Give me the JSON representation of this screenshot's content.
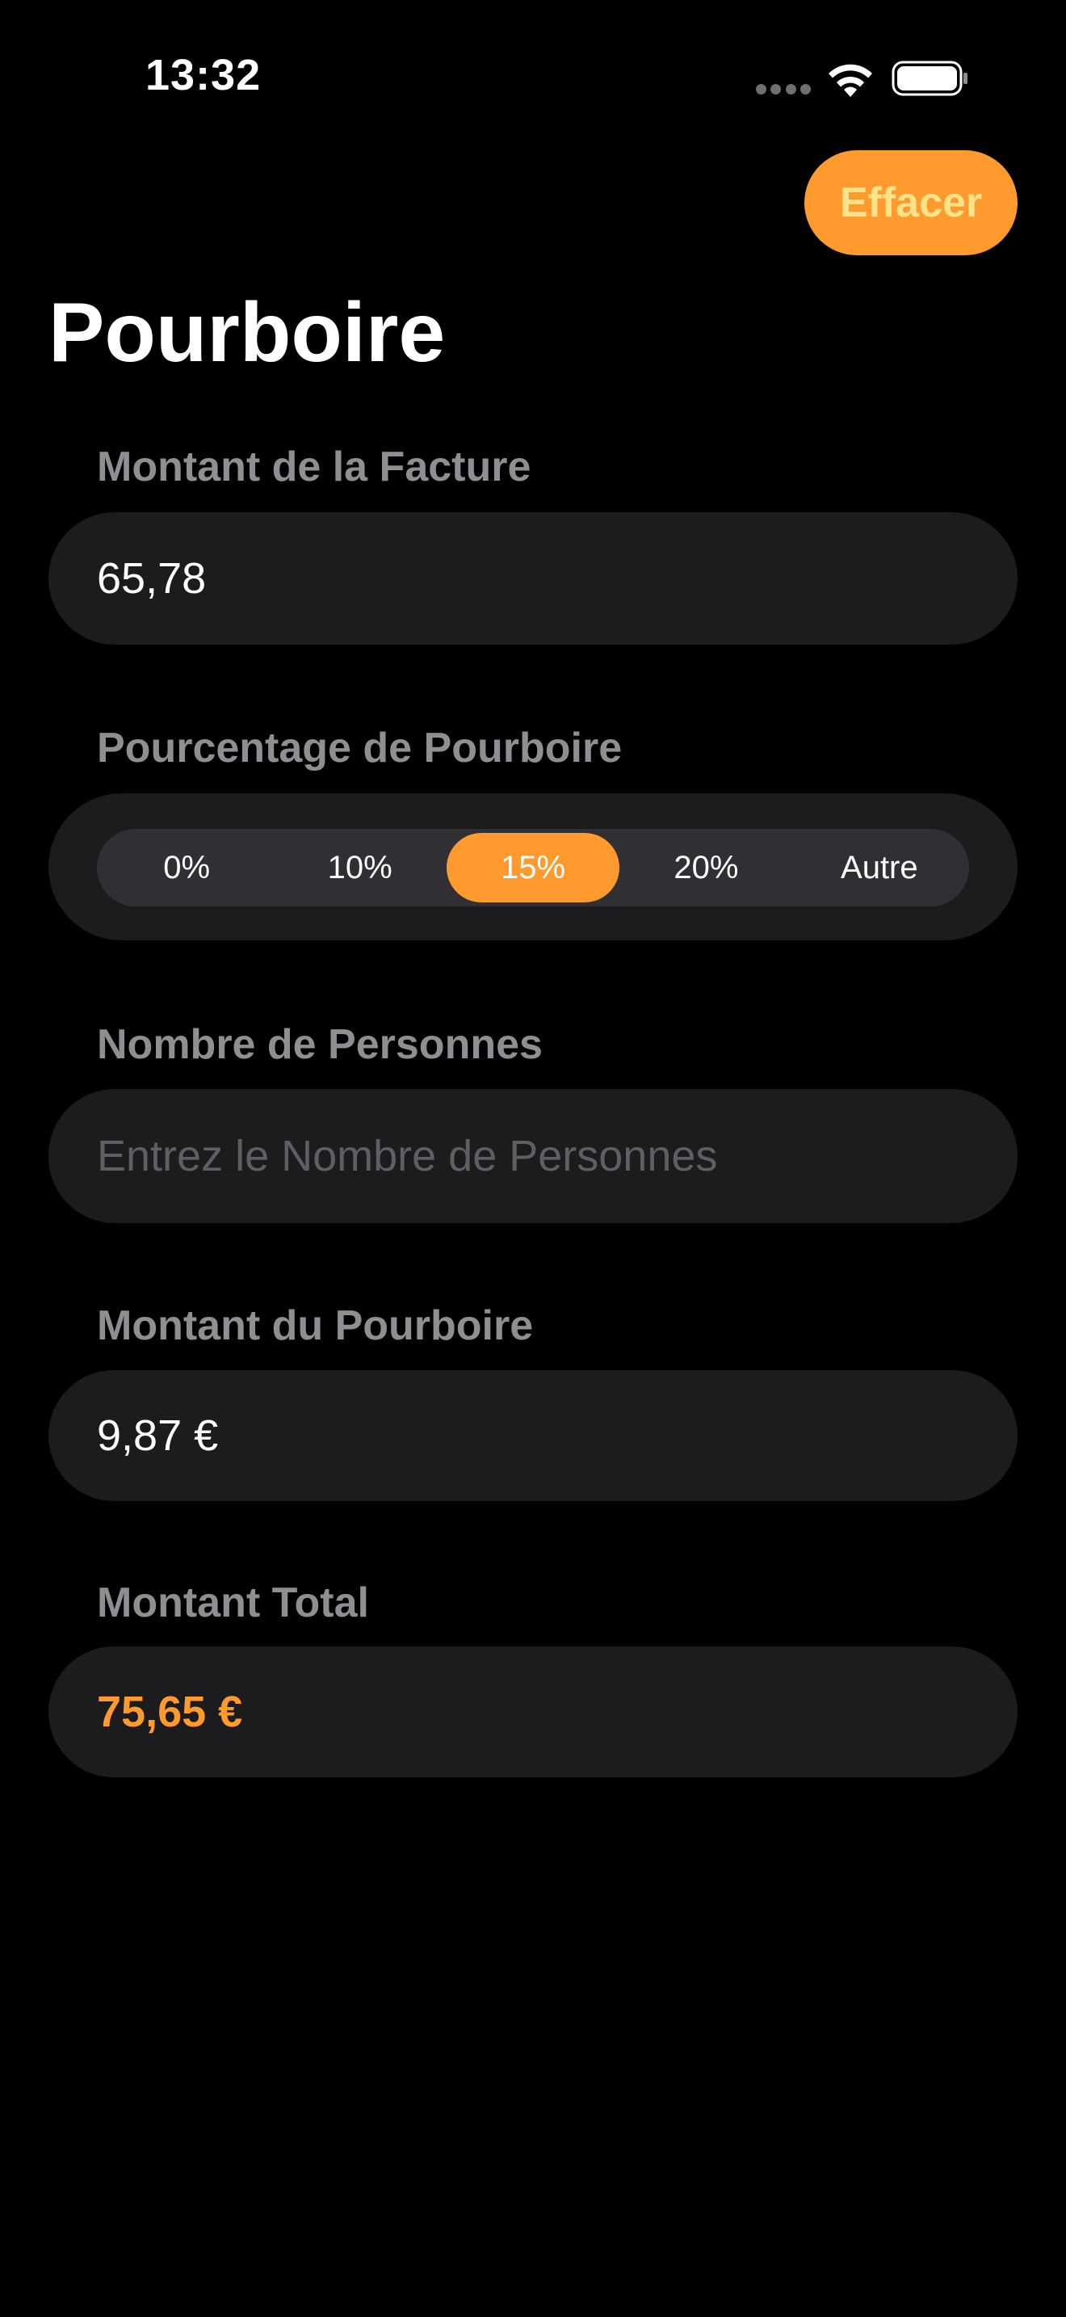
{
  "status_bar": {
    "time": "13:32",
    "icons": [
      "signal-icon",
      "wifi-icon",
      "battery-icon"
    ]
  },
  "toolbar": {
    "clear_label": "Effacer"
  },
  "page": {
    "title": "Pourboire"
  },
  "bill": {
    "label": "Montant de la Facture",
    "value": "65,78"
  },
  "tip_percentage": {
    "label": "Pourcentage de Pourboire",
    "options": [
      "0%",
      "10%",
      "15%",
      "20%",
      "Autre"
    ],
    "selected": "15%"
  },
  "people": {
    "label": "Nombre de Personnes",
    "value": "",
    "placeholder": "Entrez le Nombre de Personnes"
  },
  "tip_amount": {
    "label": "Montant du Pourboire",
    "value": "9,87 €"
  },
  "total_amount": {
    "label": "Montant Total",
    "value": "75,65 €"
  },
  "colors": {
    "accent": "#ff9a2e",
    "accent_text": "#ffe38a",
    "background": "#000000",
    "field_background": "#1c1c1e",
    "label_gray": "#8e8e93"
  }
}
